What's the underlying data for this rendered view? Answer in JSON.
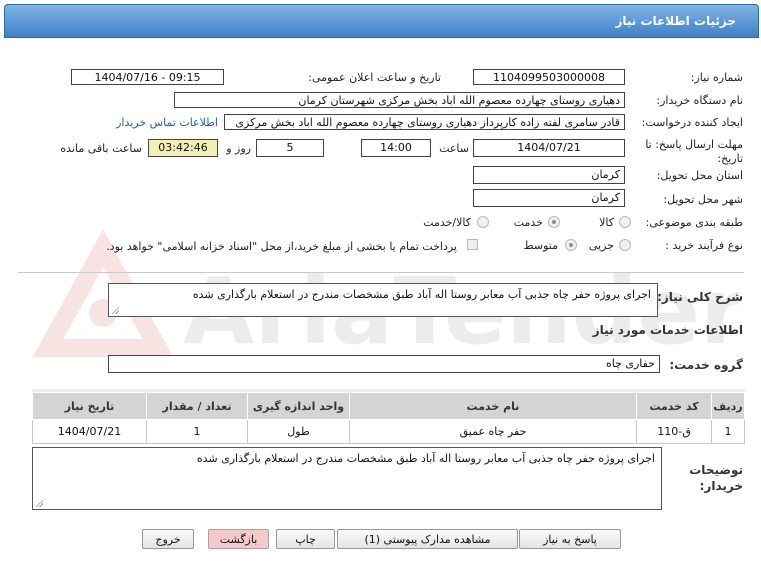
{
  "window": {
    "title": "جزئیات اطلاعات نیاز"
  },
  "form": {
    "need_number_label": "شماره نیاز:",
    "need_number": "1104099503000008",
    "announce_label": "تاریخ و ساعت اعلان عمومی:",
    "announce_value": "1404/07/16 - 09:15",
    "buyer_org_label": "نام دستگاه خریدار:",
    "buyer_org": "دهیاری روستای چهارده معصوم الله اباد بخش مرکزی شهرستان کرمان",
    "requester_label": "ایجاد کننده درخواست:",
    "requester": "قادر سامری لفته زاده کارپرداز دهیاری روستای چهارده معصوم الله اباد بخش مرکزی",
    "contact_link": "اطلاعات تماس خریدار",
    "deadline_label": "مهلت ارسال پاسخ: تا تاریخ:",
    "deadline_date": "1404/07/21",
    "time_label": "ساعت",
    "deadline_time": "14:00",
    "days_value": "5",
    "days_label": "روز و",
    "remaining_value": "03:42:46",
    "remaining_label": "ساعت باقی مانده",
    "province_label": "استان محل تحویل:",
    "province": "کرمان",
    "city_label": "شهر محل تحویل:",
    "city": "کرمان",
    "category_label": "طبقه بندی موضوعی:",
    "category_options": [
      "کالا",
      "خدمت",
      "کالا/خدمت"
    ],
    "category_selected": "خدمت",
    "process_label": "نوع فرآیند خرید :",
    "process_options": [
      "جزیی",
      "متوسط"
    ],
    "process_selected": "جزیی",
    "payment_note": "پرداخت تمام یا بخشی از مبلغ خرید،از محل \"اسناد خزانه اسلامی\" خواهد بود."
  },
  "summary": {
    "label": "شرح کلی نیاز:",
    "text": "اجرای پروژه حفر چاه جذبی آب معابر روستا اله آباد طبق مشخصات مندرج در استعلام بارگذاری شده"
  },
  "services": {
    "section_title": "اطلاعات خدمات مورد نیاز",
    "group_label": "گروه خدمت:",
    "group_value": "حفاری چاه",
    "columns": [
      "ردیف",
      "کد خدمت",
      "نام خدمت",
      "واحد اندازه گیری",
      "تعداد / مقدار",
      "تاریخ نیاز"
    ],
    "rows": [
      {
        "row": "1",
        "code": "ق-110",
        "name": "حفر چاه عمیق",
        "unit": "طول",
        "qty": "1",
        "date": "1404/07/21"
      }
    ]
  },
  "buyer_notes": {
    "label": "توضیحات خریدار:",
    "text": "اجرای پروژه حفر چاه جذبی آب معابر روستا اله آباد طبق مشخصات مندرج در استعلام بارگذاری شده"
  },
  "buttons": {
    "reply": "پاسخ به نیاز",
    "attachments": "مشاهده مدارک پیوستی (1)",
    "print": "چاپ",
    "back": "بازگشت",
    "exit": "خروج"
  },
  "colors": {
    "title_bar": "#3f80c8",
    "yellow_field": "#f3f0b5",
    "link": "#1f5fb0",
    "pink_button": "#f3c9c9"
  }
}
